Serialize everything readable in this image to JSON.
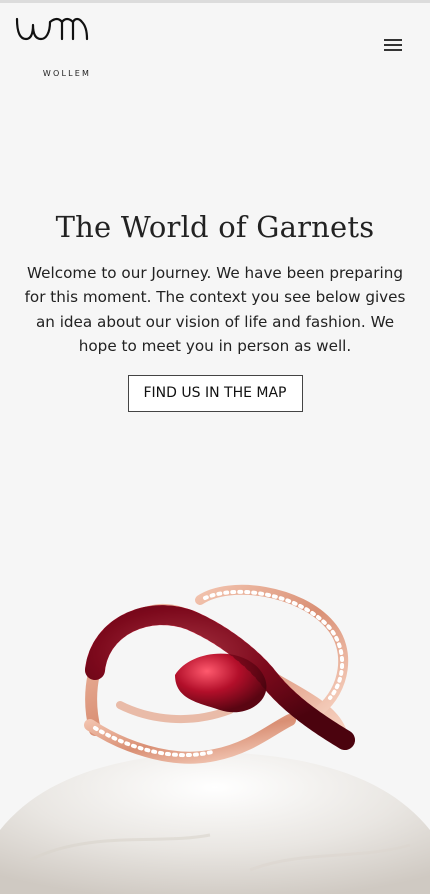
{
  "brand": {
    "logo_text": "WOLLEM"
  },
  "header": {
    "menu_icon": "hamburger-menu-icon"
  },
  "hero": {
    "title": "The World of Garnets",
    "text": "Welcome to our Journey. We have been preparing for this moment. The context you see below gives an idea about our vision of life and fashion. We hope to meet you in person as well.",
    "cta_label": "FIND US IN THE MAP"
  },
  "colors": {
    "background": "#f6f6f6",
    "text": "#222222",
    "garnet": "#b0102a",
    "rose_gold": "#e8a78f"
  }
}
